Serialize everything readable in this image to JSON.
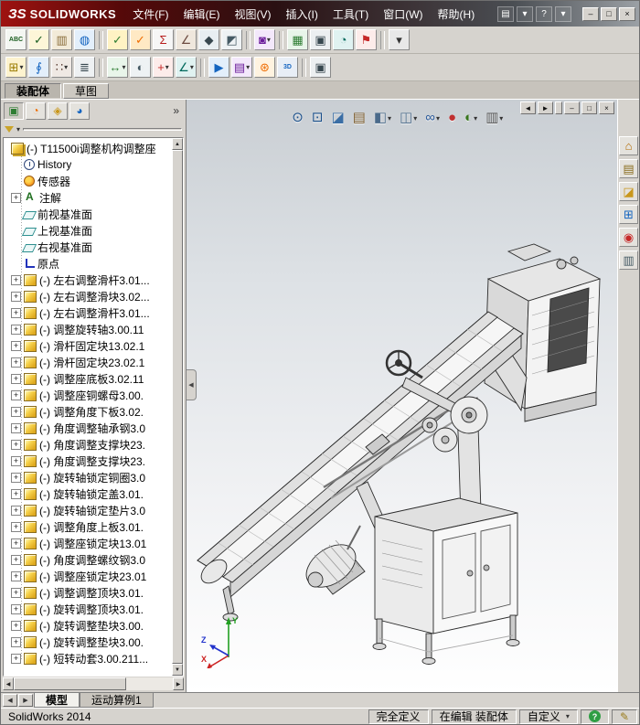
{
  "titlebar": {
    "logo_mark": "ЗS",
    "logo_text": "SOLIDWORKS",
    "menus": [
      {
        "label": "文件(F)"
      },
      {
        "label": "编辑(E)"
      },
      {
        "label": "视图(V)"
      },
      {
        "label": "插入(I)"
      },
      {
        "label": "工具(T)"
      },
      {
        "label": "窗口(W)"
      },
      {
        "label": "帮助(H)"
      }
    ],
    "quick": [
      {
        "name": "new-document-button",
        "glyph": "▤"
      },
      {
        "name": "new-document-dropdown",
        "glyph": "▾"
      },
      {
        "name": "help-menu-button",
        "glyph": "?"
      },
      {
        "name": "help-dropdown",
        "glyph": "▾"
      }
    ],
    "window_buttons": [
      {
        "name": "minimize-button",
        "glyph": "–"
      },
      {
        "name": "maximize-button",
        "glyph": "□"
      },
      {
        "name": "close-button",
        "glyph": "×"
      }
    ]
  },
  "icons": {
    "dropdown_glyph": "▾",
    "expander_glyph": "+",
    "chevron_glyph": "»",
    "scroll_up": "▲",
    "scroll_down": "▼",
    "scroll_left": "◀",
    "scroll_right": "▶",
    "splitter_glyph": "◀"
  },
  "toolbar1": {
    "items": [
      {
        "name": "spell-check-button",
        "glyph": "ABC",
        "small": true,
        "fg": "#1b5e20",
        "bg": "#f4f6f2"
      },
      {
        "name": "design-checker-button",
        "glyph": "✓",
        "fg": "#1b5e20",
        "bg": "#fdf6d8"
      },
      {
        "name": "compare-documents-button",
        "glyph": "▥",
        "fg": "#8a6d3b",
        "bg": "#f2ead8"
      },
      {
        "name": "3d-content-central-button",
        "glyph": "◍",
        "fg": "#1565c0",
        "bg": "#e3effb"
      },
      {
        "kind": "sep",
        "name": "toolbar-separator",
        "glyph": ""
      },
      {
        "name": "verification-button",
        "glyph": "✓",
        "fg": "#2e7d32",
        "bg": "#fff3c4"
      },
      {
        "name": "check-feature-button",
        "glyph": "✓",
        "fg": "#ef6c00",
        "bg": "#ffe9c4"
      },
      {
        "name": "equations-button",
        "glyph": "Σ",
        "fg": "#b71c1c",
        "bg": "#f6f6f6"
      },
      {
        "name": "measure-button",
        "glyph": "∠",
        "fg": "#6d4c41",
        "bg": "#efe7dd"
      },
      {
        "name": "mass-properties-button",
        "glyph": "◆",
        "fg": "#37474f",
        "bg": "#e8eef2"
      },
      {
        "name": "section-properties-button",
        "glyph": "◩",
        "fg": "#455a64",
        "bg": "#eef2f4"
      },
      {
        "kind": "sep",
        "name": "toolbar-separator",
        "glyph": ""
      },
      {
        "name": "edit-appearance-button",
        "glyph": "◙",
        "fg": "#6a1b9a",
        "bg": "#f3e8fb",
        "dd": true
      },
      {
        "kind": "sep",
        "name": "toolbar-separator",
        "glyph": ""
      },
      {
        "name": "simulation-button",
        "glyph": "▦",
        "fg": "#2e7d32",
        "bg": "#e8f5e9"
      },
      {
        "name": "new-window-button",
        "glyph": "▣",
        "fg": "#37474f",
        "bg": "#eceff1"
      },
      {
        "name": "task-scheduler-button",
        "glyph": "◔",
        "fg": "#00695c",
        "bg": "#e0f2f1"
      },
      {
        "name": "markup-flag-button",
        "glyph": "⚑",
        "fg": "#c62828",
        "bg": "#fdecea"
      },
      {
        "kind": "sep",
        "name": "toolbar-separator",
        "glyph": ""
      },
      {
        "name": "toolbar-options-button",
        "glyph": "▾",
        "fg": "#333333",
        "bg": "#e8e8e8"
      }
    ]
  },
  "toolbar2": {
    "items": [
      {
        "name": "insert-components-button",
        "glyph": "⊞",
        "fg": "#9a7b00",
        "bg": "#fdf3cf",
        "dd": true
      },
      {
        "name": "mate-button",
        "glyph": "∮",
        "fg": "#1565c0",
        "bg": "#e3effb"
      },
      {
        "name": "linear-component-pattern-button",
        "glyph": "∷",
        "fg": "#5d4037",
        "bg": "#efe9e4",
        "dd": true
      },
      {
        "name": "smart-fasteners-button",
        "glyph": "≣",
        "fg": "#37474f",
        "bg": "#eef1f3"
      },
      {
        "kind": "sep",
        "name": "toolbar-separator",
        "glyph": ""
      },
      {
        "name": "move-component-button",
        "glyph": "↔",
        "fg": "#2e7d32",
        "bg": "#e9f5ea",
        "dd": true
      },
      {
        "name": "show-hidden-components-button",
        "glyph": "◐",
        "fg": "#455a64",
        "bg": "#eef2f4"
      },
      {
        "name": "assembly-features-button",
        "glyph": "+",
        "fg": "#c62828",
        "bg": "#fdecea",
        "dd": true
      },
      {
        "name": "reference-geometry-button",
        "glyph": "∠",
        "fg": "#00695c",
        "bg": "#e0f2f1",
        "dd": true
      },
      {
        "kind": "sep",
        "name": "toolbar-separator",
        "glyph": ""
      },
      {
        "name": "new-motion-study-button",
        "glyph": "▶",
        "fg": "#1565c0",
        "bg": "#e3effb"
      },
      {
        "name": "bill-of-materials-button",
        "glyph": "▤",
        "fg": "#6a1b9a",
        "bg": "#f3e8fb",
        "dd": true
      },
      {
        "name": "exploded-view-button",
        "glyph": "⊛",
        "fg": "#ef6c00",
        "bg": "#fff3e0"
      },
      {
        "name": "instant3d-button",
        "glyph": "3D",
        "small": true,
        "fg": "#1565c0",
        "bg": "#e8eef6"
      },
      {
        "kind": "sep",
        "name": "toolbar-separator",
        "glyph": ""
      },
      {
        "name": "large-assembly-mode-button",
        "glyph": "▣",
        "fg": "#37474f",
        "bg": "#eceff1"
      }
    ]
  },
  "command_tabs": {
    "items": [
      {
        "label": "装配体",
        "state": "active"
      },
      {
        "label": "草图",
        "state": "normal"
      }
    ]
  },
  "left_panel": {
    "tabs": [
      {
        "name": "featuremanager-tree-tab",
        "glyph": "▣",
        "fg": "#2e7d32",
        "state": "active"
      },
      {
        "name": "propertymanager-tab",
        "glyph": "◔",
        "fg": "#ef6c00",
        "state": "normal"
      },
      {
        "name": "configurationmanager-tab",
        "glyph": "◈",
        "fg": "#c9971c",
        "state": "normal"
      },
      {
        "name": "displaymanager-tab",
        "glyph": "◕",
        "fg": "#1565c0",
        "state": "normal"
      }
    ],
    "chevron": "»"
  },
  "tree": {
    "root": {
      "label": "(-) T11500i调整机构调整座",
      "icon": "assembly-icon"
    },
    "items": [
      {
        "label": "History",
        "icon": "history-icon",
        "plus": false
      },
      {
        "label": "传感器",
        "icon": "sensor-icon",
        "plus": false
      },
      {
        "label": "注解",
        "icon": "annotations-icon",
        "plus": true
      },
      {
        "label": "前视基准面",
        "icon": "plane-icon",
        "plus": false
      },
      {
        "label": "上视基准面",
        "icon": "plane-icon",
        "plus": false
      },
      {
        "label": "右视基准面",
        "icon": "plane-icon",
        "plus": false
      },
      {
        "label": "原点",
        "icon": "origin-icon",
        "plus": false
      },
      {
        "label": "(-) 左右调整滑杆3.01...",
        "icon": "component-icon",
        "plus": true
      },
      {
        "label": "(-) 左右调整滑块3.02...",
        "icon": "component-icon",
        "plus": true
      },
      {
        "label": "(-) 左右调整滑杆3.01...",
        "icon": "component-icon",
        "plus": true
      },
      {
        "label": "(-) 调整旋转轴3.00.11",
        "icon": "component-icon",
        "plus": true
      },
      {
        "label": "(-) 滑杆固定块13.02.1",
        "icon": "component-icon",
        "plus": true
      },
      {
        "label": "(-) 滑杆固定块23.02.1",
        "icon": "component-icon",
        "plus": true
      },
      {
        "label": "(-) 调整座底板3.02.11",
        "icon": "component-icon",
        "plus": true
      },
      {
        "label": "(-) 调整座铜螺母3.00.",
        "icon": "component-icon",
        "plus": true
      },
      {
        "label": "(-) 调整角度下板3.02.",
        "icon": "component-icon",
        "plus": true
      },
      {
        "label": "(-) 角度调整轴承钢3.0",
        "icon": "component-icon",
        "plus": true
      },
      {
        "label": "(-) 角度调整支撑块23.",
        "icon": "component-icon",
        "plus": true
      },
      {
        "label": "(-) 角度调整支撑块23.",
        "icon": "component-icon",
        "plus": true
      },
      {
        "label": "(-) 旋转轴锁定铜圈3.0",
        "icon": "component-icon",
        "plus": true
      },
      {
        "label": "(-) 旋转轴锁定盖3.01.",
        "icon": "component-icon",
        "plus": true
      },
      {
        "label": "(-) 旋转轴锁定垫片3.0",
        "icon": "component-icon",
        "plus": true
      },
      {
        "label": "(-) 调整角度上板3.01.",
        "icon": "component-icon",
        "plus": true
      },
      {
        "label": "(-) 调整座锁定块13.01",
        "icon": "component-icon",
        "plus": true
      },
      {
        "label": "(-) 角度调整螺纹钢3.0",
        "icon": "component-icon",
        "plus": true
      },
      {
        "label": "(-) 调整座锁定块23.01",
        "icon": "component-icon",
        "plus": true
      },
      {
        "label": "(-) 调整调整顶块3.01.",
        "icon": "component-icon",
        "plus": true
      },
      {
        "label": "(-) 旋转调整顶块3.01.",
        "icon": "component-icon",
        "plus": true
      },
      {
        "label": "(-) 旋转调整垫块3.00.",
        "icon": "component-icon",
        "plus": true
      },
      {
        "label": "(-) 旋转调整垫块3.00.",
        "icon": "component-icon",
        "plus": true
      },
      {
        "label": "(-) 短转动套3.00.211...",
        "icon": "component-icon",
        "plus": true
      }
    ]
  },
  "headsup": {
    "items": [
      {
        "name": "zoom-to-fit-button",
        "glyph": "⊙",
        "fg": "#1a4f8a"
      },
      {
        "name": "zoom-to-area-button",
        "glyph": "⊡",
        "fg": "#1a4f8a"
      },
      {
        "name": "section-view-button",
        "glyph": "◪",
        "fg": "#3a6ea5"
      },
      {
        "name": "3d-drawing-view-button",
        "glyph": "▤",
        "fg": "#7a5a2a"
      },
      {
        "name": "view-orientation-button",
        "glyph": "◧",
        "fg": "#4a6a8a",
        "dd": true
      },
      {
        "name": "display-style-button",
        "glyph": "◫",
        "fg": "#4a6a8a",
        "dd": true
      },
      {
        "name": "hide-show-items-button",
        "glyph": "∞",
        "fg": "#2a5a9a",
        "dd": true
      },
      {
        "name": "edit-appearance-button",
        "glyph": "●",
        "fg": "#c03030"
      },
      {
        "name": "apply-scene-button",
        "glyph": "◐",
        "fg": "#38761d",
        "dd": true
      },
      {
        "name": "view-settings-button",
        "glyph": "▥",
        "fg": "#555555",
        "dd": true
      }
    ]
  },
  "doc_controls": [
    {
      "name": "previous-document-button",
      "glyph": "◄"
    },
    {
      "name": "next-document-button",
      "glyph": "►"
    },
    {
      "kind": "gap",
      "name": "spacer",
      "glyph": ""
    },
    {
      "name": "doc-minimize-button",
      "glyph": "–"
    },
    {
      "name": "doc-restore-button",
      "glyph": "□"
    },
    {
      "name": "doc-close-button",
      "glyph": "×"
    }
  ],
  "taskpane": {
    "items": [
      {
        "name": "task-pane-home-button",
        "glyph": "⌂",
        "fg": "#b26a00"
      },
      {
        "name": "design-library-button",
        "glyph": "▤",
        "fg": "#8a6d1f"
      },
      {
        "name": "file-explorer-button",
        "glyph": "◪",
        "fg": "#c9971c"
      },
      {
        "name": "view-palette-button",
        "glyph": "⊞",
        "fg": "#1565c0"
      },
      {
        "name": "appearances-scenes-button",
        "glyph": "◉",
        "fg": "#c62828"
      },
      {
        "name": "custom-properties-button",
        "glyph": "▥",
        "fg": "#455a64"
      }
    ]
  },
  "doc_tabs": {
    "items": [
      {
        "label": "模型",
        "state": "active"
      },
      {
        "label": "运动算例1",
        "state": "normal"
      }
    ]
  },
  "statusbar": {
    "app": "SolidWorks 2014",
    "defined": "完全定义",
    "editing": "在编辑 装配体",
    "custom": "自定义",
    "help_glyph": "?",
    "pencil_glyph": "✎"
  },
  "triad": {
    "x": "X",
    "y": "Y",
    "z": "Z",
    "x_color": "#cc2222",
    "y_color": "#22a022",
    "z_color": "#2233cc"
  }
}
